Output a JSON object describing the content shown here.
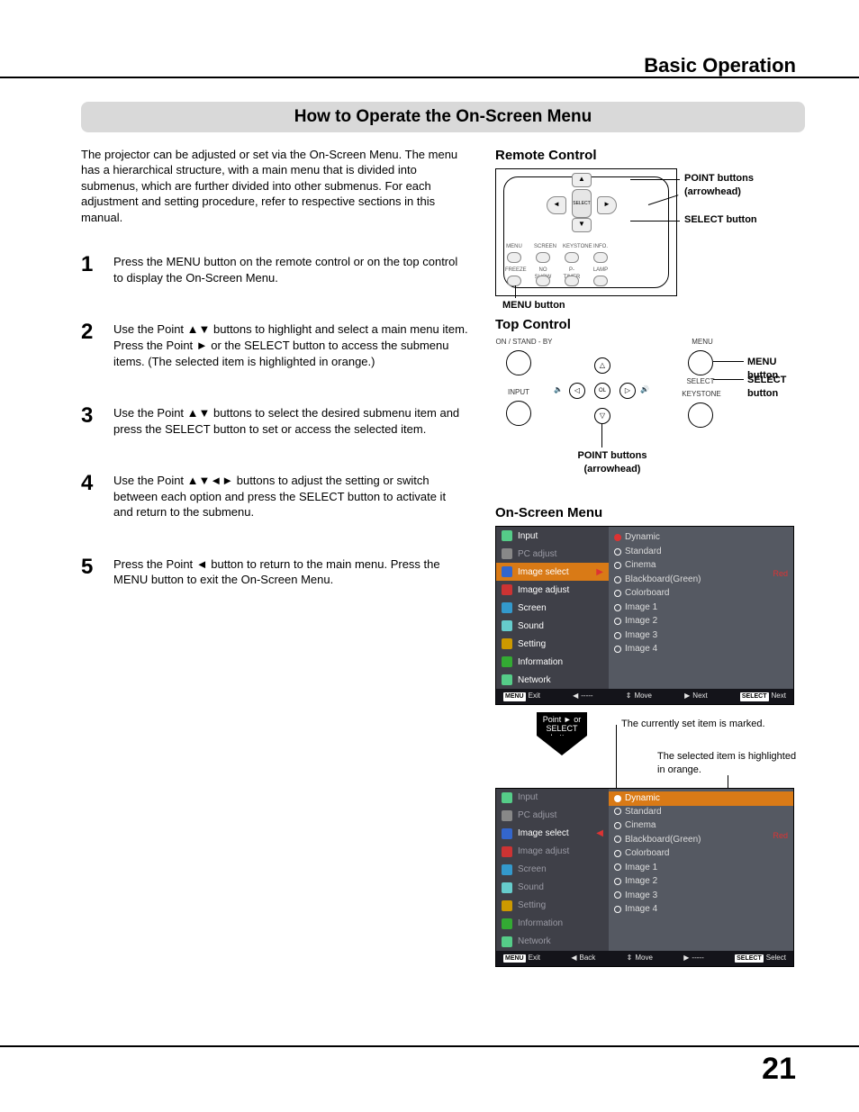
{
  "breadcrumb": "Basic Operation",
  "title": "How to Operate the On-Screen Menu",
  "intro": "The projector can be adjusted or set via the On-Screen Menu. The menu has a hierarchical structure, with a main menu that is divided into submenus, which are further divided into other submenus. For each adjustment and setting procedure, refer to respective sections in this manual.",
  "steps": [
    "Press the MENU button on the remote control or on the top control to display the On-Screen Menu.",
    "Use the Point ▲▼ buttons to highlight and select a main menu item. Press the Point ► or the SELECT button to access the submenu items. (The selected item is highlighted in orange.)",
    "Use the Point ▲▼ buttons to select the desired submenu item and press the SELECT button to set or access the selected item.",
    "Use the Point ▲▼◄► buttons to adjust the setting or switch between each option and press the SELECT button to activate it and return to the submenu.",
    "Press the Point ◄ button to return to the main menu. Press the MENU button to exit the On-Screen Menu."
  ],
  "remote": {
    "heading": "Remote Control",
    "labels": {
      "point": "POINT buttons (arrowhead)",
      "select": "SELECT button",
      "menu": "MENU button"
    },
    "row1": [
      "MENU",
      "SCREEN",
      "KEYSTONE",
      "INFO."
    ],
    "row2": [
      "FREEZE",
      "NO SHOW",
      "P-TIMER",
      "LAMP"
    ]
  },
  "top_control": {
    "heading": "Top Control",
    "labels": {
      "standby": "ON / STAND - BY",
      "input": "INPUT",
      "menu": "MENU",
      "select": "SELECT",
      "keystone": "KEYSTONE",
      "point": "POINT buttons (arrowhead)",
      "menu_btn": "MENU button",
      "select_btn": "SELECT button"
    }
  },
  "osd": {
    "heading": "On-Screen Menu",
    "main_items": [
      "Input",
      "PC adjust",
      "Image select",
      "Image adjust",
      "Screen",
      "Sound",
      "Setting",
      "Information",
      "Network"
    ],
    "sub_items": [
      "Dynamic",
      "Standard",
      "Cinema",
      "Blackboard(Green)",
      "Colorboard",
      "Image 1",
      "Image 2",
      "Image 3",
      "Image 4"
    ],
    "red_label": "Red",
    "bar1": {
      "exit": "Exit",
      "blank": "-----",
      "move": "Move",
      "next": "Next",
      "select": "Next"
    },
    "bar2": {
      "exit": "Exit",
      "back": "Back",
      "move": "Move",
      "next": "-----",
      "select": "Select"
    },
    "arrow_text": "Point ► or SELECT button",
    "callout_marked": "The currently set item is marked.",
    "callout_selected": "The selected item is highlighted in orange."
  },
  "page_number": "21"
}
